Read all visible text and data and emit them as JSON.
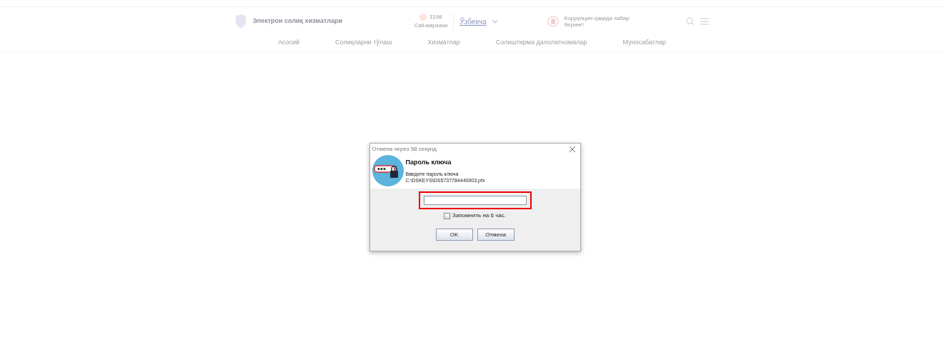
{
  "header": {
    "site_title": "Электрон солиқ хизматлари",
    "call_center": {
      "number": "1198",
      "label": "Call-маркази"
    },
    "language": "Ўзбекча",
    "corruption_report": "Коррупция ҳақида хабар беринг!"
  },
  "nav": [
    {
      "label": "Асосий"
    },
    {
      "label": "Солиқларни тўлаш"
    },
    {
      "label": "Хизматлар"
    },
    {
      "label": "Солиштирма далолатномалар"
    },
    {
      "label": "Муносабатлар"
    }
  ],
  "dialog": {
    "title": "Отмена через 58 секунд",
    "heading": "Пароль ключа",
    "prompt": "Введите пароль ключа",
    "file_path": "C:\\DSKEYS\\DS5737784440003.pfx",
    "password_highlighted": true,
    "remember": {
      "label": "Запомнить на 6 час.",
      "checked": false
    },
    "buttons": [
      "OK",
      "Отмена"
    ]
  }
}
